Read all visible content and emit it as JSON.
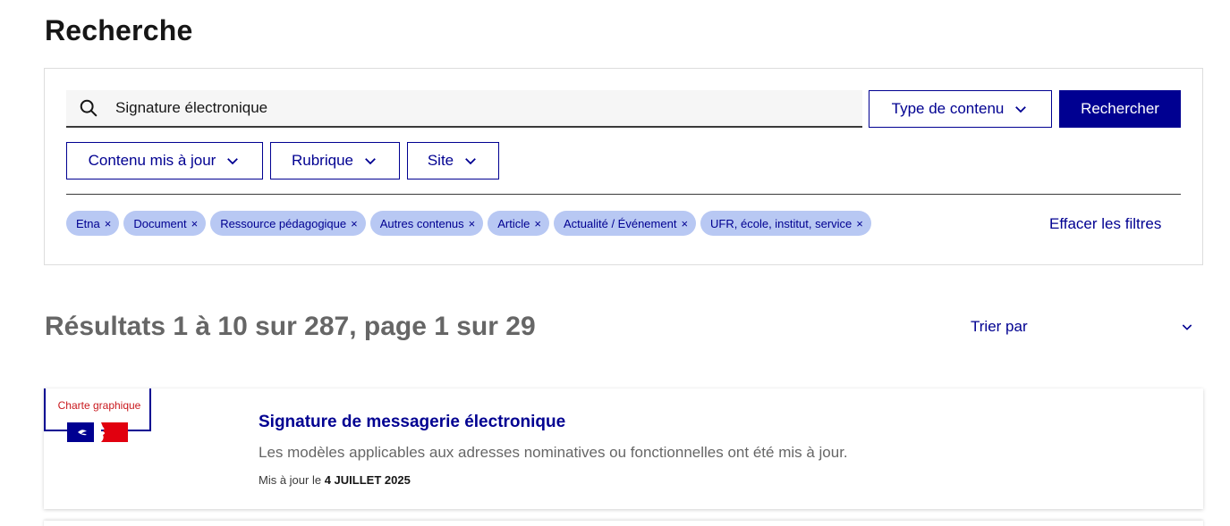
{
  "page": {
    "title": "Recherche"
  },
  "search": {
    "value": "Signature électronique",
    "placeholder": "",
    "submit_label": "Rechercher"
  },
  "filters": {
    "content_type": "Type de contenu",
    "updated": "Contenu mis à jour",
    "rubrique": "Rubrique",
    "site": "Site"
  },
  "tags": [
    {
      "label": "Etna"
    },
    {
      "label": "Document"
    },
    {
      "label": "Ressource pédagogique"
    },
    {
      "label": "Autres contenus"
    },
    {
      "label": "Article"
    },
    {
      "label": "Actualité / Événement"
    },
    {
      "label": "UFR, école, institut, service"
    }
  ],
  "tag_remove_glyph": "×",
  "clear_filters_label": "Effacer les filtres",
  "results": {
    "summary": "Résultats 1 à 10 sur 287, page 1 sur 29",
    "sort_label": "Trier par"
  },
  "result_items": [
    {
      "badge": "Charte graphique",
      "title": "Signature de messagerie électronique",
      "description": "Les modèles applicables aux adresses nominatives ou fonctionnelles ont été mis à jour.",
      "meta_prefix": "Mis à jour le ",
      "meta_date": "4 JUILLET 2025"
    }
  ],
  "colors": {
    "primary": "#000091",
    "tag_bg": "#b8c8f3",
    "badge_red": "#c9191e",
    "muted_text": "#666666"
  },
  "icons": {
    "search": "search-icon",
    "chevron": "chevron-down-icon",
    "close": "close-icon",
    "flag": "marianne-flag-icon"
  }
}
